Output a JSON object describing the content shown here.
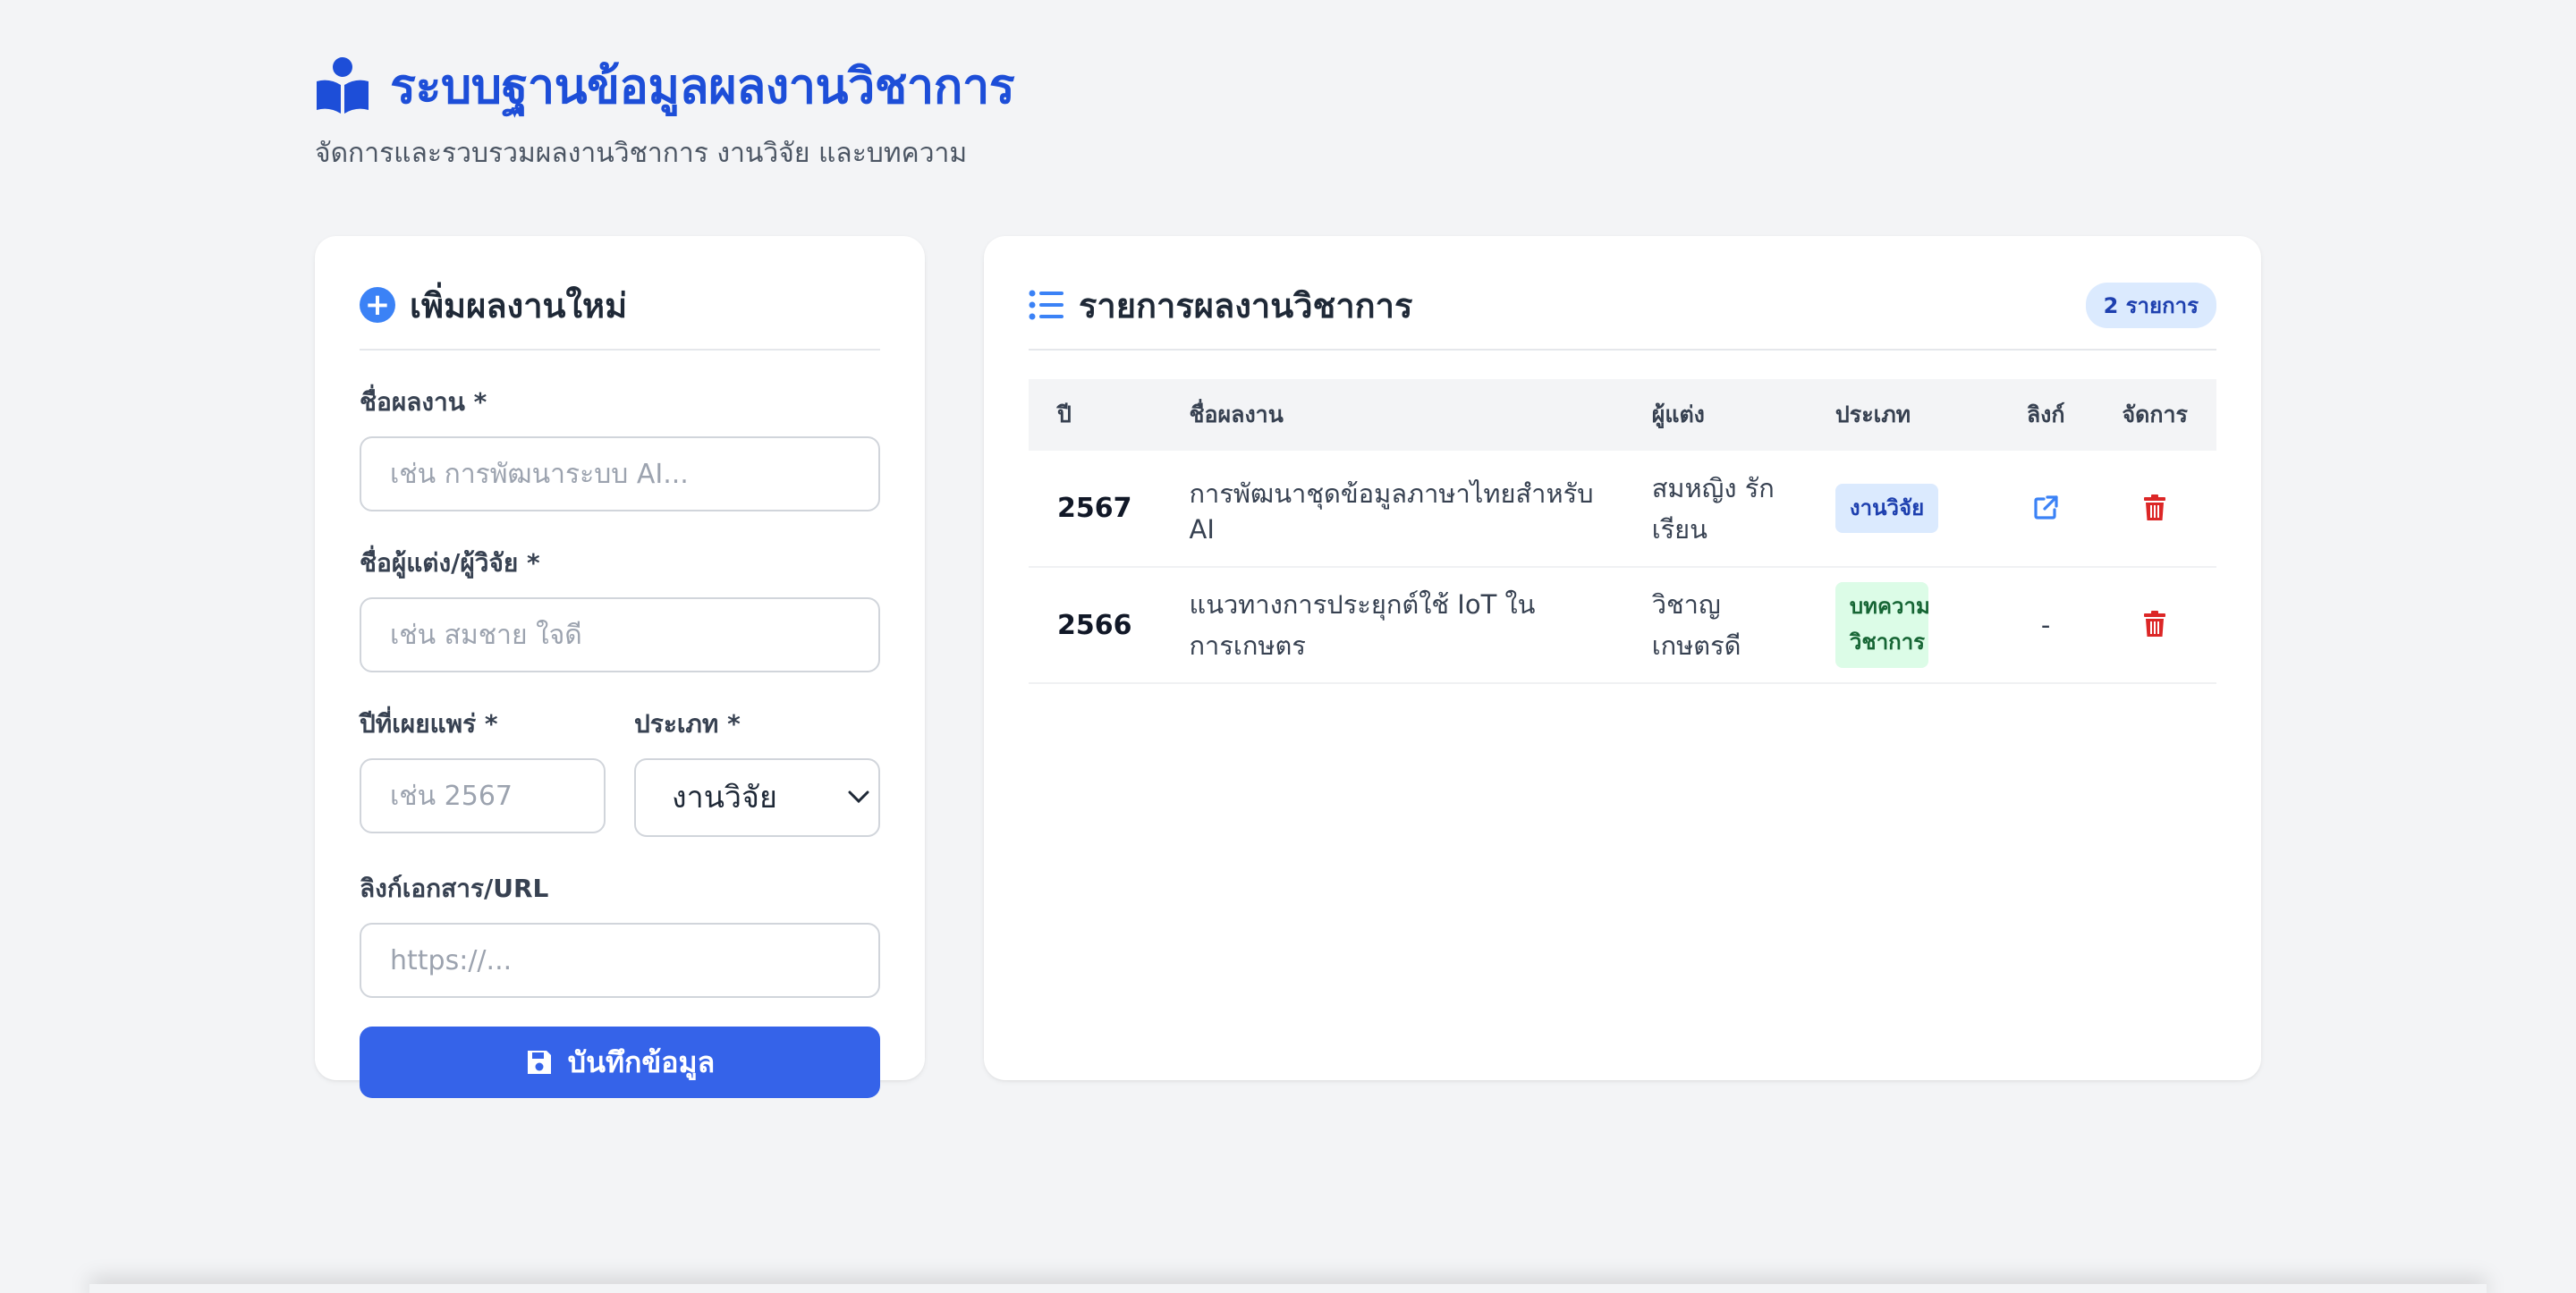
{
  "header": {
    "title": "ระบบฐานข้อมูลผลงานวิชาการ",
    "subtitle": "จัดการและรวบรวมผลงานวิชาการ งานวิจัย และบทความ",
    "icon": "book-reader-icon",
    "accent": "#1d4ed8"
  },
  "form": {
    "heading": "เพิ่มผลงานใหม่",
    "title_label": "ชื่อผลงาน *",
    "title_placeholder": "เช่น การพัฒนาระบบ AI...",
    "author_label": "ชื่อผู้แต่ง/ผู้วิจัย *",
    "author_placeholder": "เช่น สมชาย ใจดี",
    "year_label": "ปีที่เผยแพร่ *",
    "year_placeholder": "เช่น 2567",
    "type_label": "ประเภท *",
    "type_selected": "งานวิจัย",
    "url_label": "ลิงก์เอกสาร/URL",
    "url_placeholder": "https://...",
    "save_label": "บันทึกข้อมูล",
    "button_color": "#3563e9"
  },
  "list": {
    "heading": "รายการผลงานวิชาการ",
    "count_badge": "2 รายการ",
    "columns": {
      "year": "ปี",
      "title": "ชื่อผลงาน",
      "author": "ผู้แต่ง",
      "type": "ประเภท",
      "link": "ลิงก์",
      "actions": "จัดการ"
    },
    "rows": [
      {
        "year": "2567",
        "title": "การพัฒนาชุดข้อมูลภาษาไทยสำหรับ AI",
        "author": "สมหญิง รักเรียน",
        "type": "งานวิจัย",
        "link_icon": "external-link-icon",
        "delete_icon": "trash-icon"
      },
      {
        "year": "2566",
        "title": "แนวทางการประยุกต์ใช้ IoT ในการเกษตร",
        "author": "วิชาญ เกษตรดี",
        "type": "บทความวิชาการ",
        "link_text": "-",
        "delete_icon": "trash-icon"
      }
    ]
  }
}
